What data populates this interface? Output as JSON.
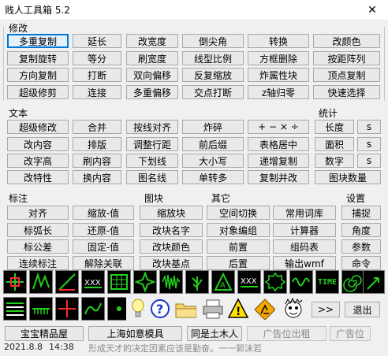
{
  "window": {
    "title": "贱人工具箱 5.2",
    "close_glyph": "✕"
  },
  "sections": {
    "modify": "修改",
    "text": "文本",
    "stats": "统计",
    "annotate": "标注",
    "block": "图块",
    "other": "其它",
    "settings": "设置"
  },
  "modify_rows": [
    [
      "多重复制",
      "延长",
      "改宽度",
      "倒尖角",
      "转换",
      "改颜色"
    ],
    [
      "复制旋转",
      "等分",
      "刷宽度",
      "线型比例",
      "方框删除",
      "按距阵列"
    ],
    [
      "方向复制",
      "打断",
      "双向偏移",
      "反复缩放",
      "炸属性块",
      "顶点复制"
    ],
    [
      "超级修剪",
      "连接",
      "多重偏移",
      "交点打断",
      "z轴归零",
      "快速选择"
    ]
  ],
  "text_rows": [
    [
      "超级修改",
      "合并",
      "按线对齐",
      "炸碎",
      "+ − × ÷"
    ],
    [
      "改内容",
      "排版",
      "调整行距",
      "前后缀",
      "表格居中"
    ],
    [
      "改字高",
      "刷内容",
      "下划线",
      "大小写",
      "递增复制"
    ],
    [
      "改特性",
      "换内容",
      "图名线",
      "单转多",
      "复制并改"
    ]
  ],
  "stats_rows": [
    {
      "label": "长度",
      "side": "s"
    },
    {
      "label": "面积",
      "side": "s"
    },
    {
      "label": "数字",
      "side": "s"
    },
    {
      "label": "图块数量",
      "side": ""
    }
  ],
  "annotate_rows": [
    [
      "对齐",
      "缩放-值"
    ],
    [
      "标弧长",
      "还原-值"
    ],
    [
      "标公差",
      "固定-值"
    ],
    [
      "连续标注",
      "解除关联"
    ]
  ],
  "block_buttons": [
    "缩放块",
    "改块名字",
    "改块颜色",
    "改块基点"
  ],
  "other_rows": [
    [
      "空间切换",
      "常用词库"
    ],
    [
      "对象编组",
      "计算器"
    ],
    [
      "前置",
      "组码表"
    ],
    [
      "后置",
      "输出wmf"
    ]
  ],
  "settings_buttons": [
    "捕捉",
    "角度",
    "参数",
    "命令"
  ],
  "toolbar_icons_row1": [
    "coordinate-icon",
    "zigzag-line-icon",
    "diagonal-line-icon",
    "xxx-pattern-icon",
    "grid-table-icon",
    "star-icon",
    "waveform-icon",
    "grass-icon",
    "a-triangle-icon",
    "xxx-line-icon",
    "gear-outline-icon",
    "sine-wave-icon",
    "time-icon",
    "spiral-icon",
    "hook-arrow-icon"
  ],
  "toolbar_icons_row2": [
    "stripes-icon",
    "comb-icon",
    "cross-hair-icon",
    "wave-arrows-icon",
    "dot-icon",
    "light-bulb-icon",
    "help-icon",
    "folder-icon",
    "printer-icon",
    "warning-icon",
    "construction-icon",
    "crazy-face-icon"
  ],
  "toolbar_labels": {
    "time": "TIME",
    "xxx": "XXX",
    "help": "?",
    "warning": "!"
  },
  "forward_label": ">>",
  "exit_label": "退出",
  "ads": [
    "宝宝精品屋",
    "上海如意模具",
    "同是土木人",
    "广告位出租",
    "广告位"
  ],
  "status": {
    "date": "2021.8.8",
    "time": "14:38",
    "motto": "形成天才的决定因素应该是勤奋。一一郭沫若"
  },
  "colors": {
    "accent": "#0078d7",
    "icon_bg": "#000000",
    "icon_green": "#22d01c",
    "icon_red": "#ff2a2a"
  }
}
